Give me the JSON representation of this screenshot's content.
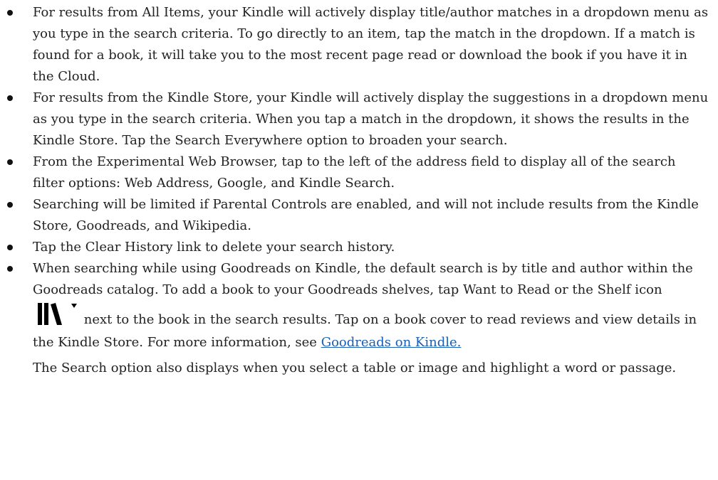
{
  "bullets": [
    "For results from All Items, your Kindle will actively display title/author matches in a dropdown menu as you type in the search criteria. To go directly to an item, tap the match in the dropdown. If a match is found for a book, it will take you to the most recent page read or download the book if you have it in the Cloud.",
    "For results from the Kindle Store, your Kindle will actively display the suggestions in a dropdown menu as you type in the search criteria. When you tap a match in the dropdown, it shows the results in the Kindle Store. Tap the Search Everywhere option to broaden your search.",
    "From the Experimental Web Browser, tap to the left of the address field to display all of the search filter options: Web Address, Google, and Kindle Search.",
    "Searching will be limited if Parental Controls are enabled, and will not include results from the Kindle Store, Goodreads, and Wikipedia.",
    "Tap the Clear History link to delete your search history."
  ],
  "goodreads_item": {
    "before_icon": "When searching while using Goodreads on Kindle, the default search is by title and author within the Goodreads catalog. To add a book to your Goodreads shelves, tap Want to Read or the Shelf icon",
    "icon_name": "shelf-icon",
    "after_icon": "next to the book in the search results. Tap on a book cover to read reviews and view details in the Kindle Store. For more information, see",
    "link_text": "Goodreads on Kindle."
  },
  "note": "The Search option also displays when you select a table or image and highlight a word or passage."
}
